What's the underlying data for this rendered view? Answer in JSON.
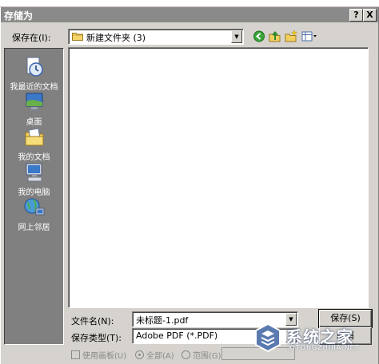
{
  "dialog": {
    "title": "存储为",
    "help_label": "?",
    "close_label": "X"
  },
  "save_in": {
    "label": "保存在(I):",
    "value": "新建文件夹 (3)"
  },
  "toolbar": {
    "icons": [
      "back-icon",
      "up-folder-icon",
      "new-folder-icon",
      "view-menu-icon"
    ]
  },
  "places": [
    {
      "label": "我最近的文档",
      "icon": "recent-documents-icon"
    },
    {
      "label": "桌面",
      "icon": "desktop-icon"
    },
    {
      "label": "我的文档",
      "icon": "my-documents-icon"
    },
    {
      "label": "我的电脑",
      "icon": "my-computer-icon"
    },
    {
      "label": "网上邻居",
      "icon": "network-places-icon"
    }
  ],
  "filename": {
    "label": "文件名(N):",
    "value": "未标题-1.pdf"
  },
  "filetype": {
    "label": "保存类型(T):",
    "value": "Adobe PDF (*.PDF)"
  },
  "buttons": {
    "save": "保存(S)",
    "cancel": "取消"
  },
  "options": {
    "use_artboards": "使用画板(U)",
    "range_all": "全部(A)",
    "range_pages": "范围(G)",
    "range_all_selected": true
  },
  "watermark": {
    "title": "系统之家",
    "url": "XITONGZHIJIA.NET"
  },
  "colors": {
    "titlebar": "#8a8a8a",
    "dialog_face": "#d6d3ce",
    "places_bar": "#808080"
  }
}
